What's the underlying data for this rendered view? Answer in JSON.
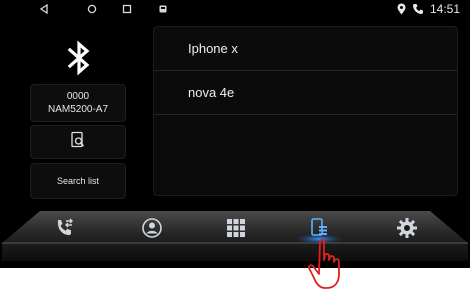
{
  "status_bar": {
    "time": "14:51",
    "icons": [
      "back-icon",
      "home-icon",
      "recents-icon",
      "app-icon",
      "location-icon",
      "phone-icon"
    ]
  },
  "left_panel": {
    "pin": "0000",
    "device_name": "NAM5200-A7",
    "search_list_label": "Search list"
  },
  "device_list": {
    "items": [
      {
        "name": "Iphone x"
      },
      {
        "name": "nova 4e"
      }
    ]
  },
  "dock": {
    "items": [
      {
        "icon": "call-transfer-icon"
      },
      {
        "icon": "contacts-icon"
      },
      {
        "icon": "dialpad-icon"
      },
      {
        "icon": "phone-device-icon",
        "active": true
      },
      {
        "icon": "settings-icon"
      }
    ]
  },
  "colors": {
    "background": "#000000",
    "text": "#f0f0f0",
    "accent": "#2e8fff",
    "cursor": "#e02020"
  }
}
